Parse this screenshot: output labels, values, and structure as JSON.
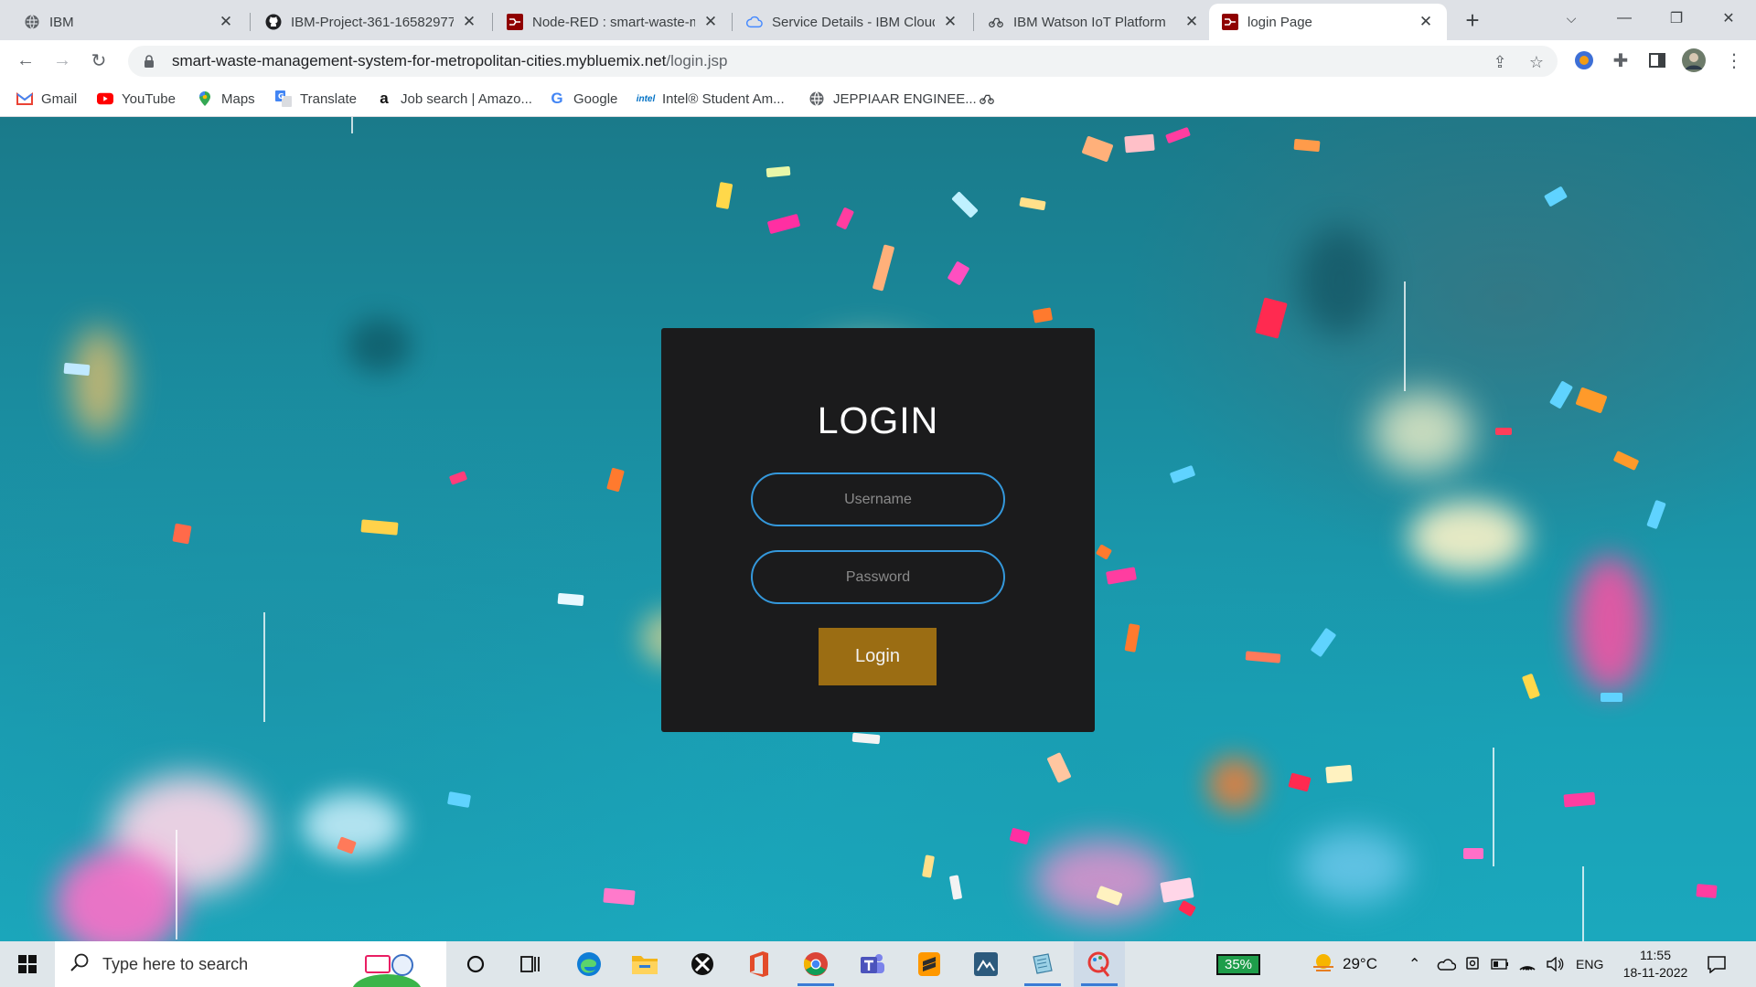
{
  "browser": {
    "tabs": [
      {
        "title": "IBM",
        "favicon": "globe-icon"
      },
      {
        "title": "IBM-Project-361-16582977",
        "favicon": "github-icon"
      },
      {
        "title": "Node-RED : smart-waste-m",
        "favicon": "node-red-icon"
      },
      {
        "title": "Service Details - IBM Cloud",
        "favicon": "cloud-icon"
      },
      {
        "title": "IBM Watson IoT Platform",
        "favicon": "iot-icon"
      },
      {
        "title": "login Page",
        "favicon": "node-red-icon",
        "active": true
      }
    ],
    "new_tab": "+",
    "url_host": "smart-waste-management-system-for-metropolitan-cities.mybluemix.net",
    "url_path": "/login.jsp",
    "bookmarks": [
      {
        "label": "Gmail",
        "icon": "gmail-icon"
      },
      {
        "label": "YouTube",
        "icon": "youtube-icon"
      },
      {
        "label": "Maps",
        "icon": "maps-icon"
      },
      {
        "label": "Translate",
        "icon": "translate-icon"
      },
      {
        "label": "Job search | Amazo...",
        "icon": "amazon-icon"
      },
      {
        "label": "Google",
        "icon": "google-icon"
      },
      {
        "label": "Intel® Student Am...",
        "icon": "intel-icon"
      },
      {
        "label": "JEPPIAAR ENGINEE...",
        "icon": "globe-icon"
      }
    ]
  },
  "login": {
    "title": "LOGIN",
    "username_placeholder": "Username",
    "password_placeholder": "Password",
    "button": "Login"
  },
  "taskbar": {
    "search_placeholder": "Type here to search",
    "battery": "35%",
    "weather": "29°C",
    "language": "ENG",
    "time": "11:55",
    "date": "18-11-2022"
  },
  "colors": {
    "card": "#1b1b1c",
    "field_border": "#3498db",
    "button": "#9b6d13",
    "background": "#1a8fa2"
  }
}
